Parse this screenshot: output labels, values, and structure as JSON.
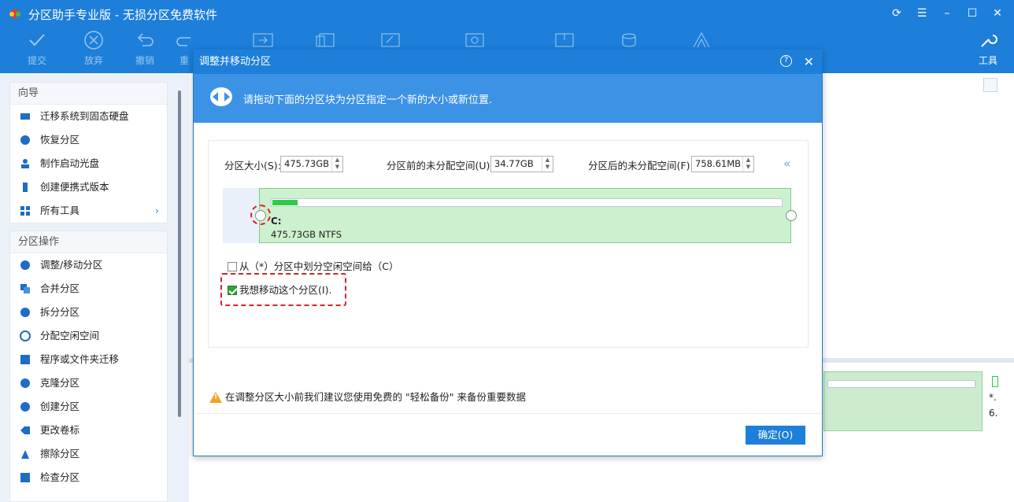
{
  "app": {
    "title": "分区助手专业版 - 无损分区免费软件"
  },
  "toolbar": {
    "submit": "提交",
    "discard": "放弃",
    "undo": "撤销",
    "redo": "重",
    "tools": "工具"
  },
  "sidebar": {
    "wizard_title": "向导",
    "wizard_items": [
      {
        "label": "迁移系统到固态硬盘"
      },
      {
        "label": "恢复分区"
      },
      {
        "label": "制作启动光盘"
      },
      {
        "label": "创建便携式版本"
      },
      {
        "label": "所有工具"
      }
    ],
    "ops_title": "分区操作",
    "ops_items": [
      {
        "label": "调整/移动分区"
      },
      {
        "label": "合并分区"
      },
      {
        "label": "拆分分区"
      },
      {
        "label": "分配空闲空间"
      },
      {
        "label": "程序或文件夹迁移"
      },
      {
        "label": "克隆分区"
      },
      {
        "label": "创建分区"
      },
      {
        "label": "更改卷标"
      },
      {
        "label": "擦除分区"
      },
      {
        "label": "检查分区"
      }
    ]
  },
  "disk_panel": {
    "right_char1": "*.",
    "right_char2": "6."
  },
  "dialog": {
    "title": "调整并移动分区",
    "banner_text": "请拖动下面的分区块为分区指定一个新的大小或新位置.",
    "size_label": "分区大小(S):",
    "size_value": "475.73GB",
    "before_label": "分区前的未分配空间(U):",
    "before_value": "34.77GB",
    "after_label": "分区后的未分配空间(F):",
    "after_value": "758.61MB",
    "partition_letter": "C:",
    "partition_info": "475.73GB NTFS",
    "usage_fraction": 0.05,
    "checkbox1_label": "从（*）分区中划分空闲空间给（C）",
    "checkbox1_checked": false,
    "checkbox2_label": "我想移动这个分区(I).",
    "checkbox2_checked": true,
    "warning_text": "在调整分区大小前我们建议您使用免费的 \"轻松备份\" 来备份重要数据",
    "ok_label": "确定(O)"
  },
  "colors": {
    "accent": "#1d7fd9",
    "partition_green": "#cdf0cf",
    "highlight_red": "#e01f1f"
  }
}
